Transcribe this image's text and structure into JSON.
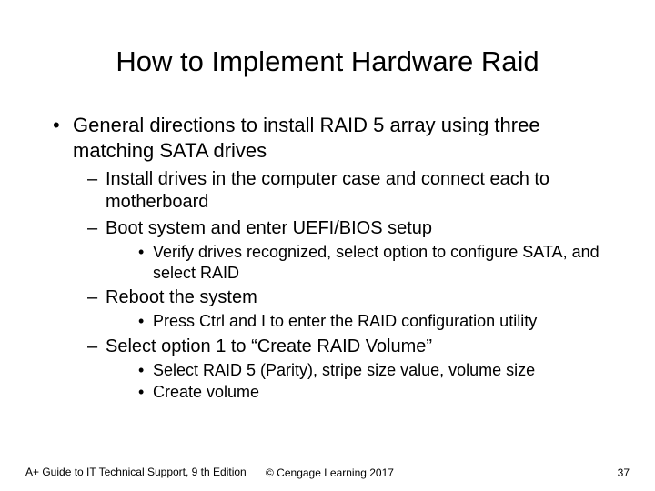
{
  "title": "How to Implement Hardware Raid",
  "bullets": {
    "b1": "General directions to install RAID 5 array using three matching SATA drives",
    "b1_1": "Install drives in the computer case and connect each to motherboard",
    "b1_2": "Boot system and enter UEFI/BIOS setup",
    "b1_2_1": "Verify drives recognized, select option to configure SATA, and select RAID",
    "b1_3": "Reboot the system",
    "b1_3_1": "Press Ctrl and I to enter the RAID configuration utility",
    "b1_4": "Select option 1 to “Create RAID Volume”",
    "b1_4_1": "Select RAID 5 (Parity), stripe size value, volume size",
    "b1_4_2": "Create volume"
  },
  "footer": {
    "left": "A+ Guide to IT Technical Support, 9 th Edition",
    "center": "© Cengage Learning  2017",
    "page": "37"
  }
}
